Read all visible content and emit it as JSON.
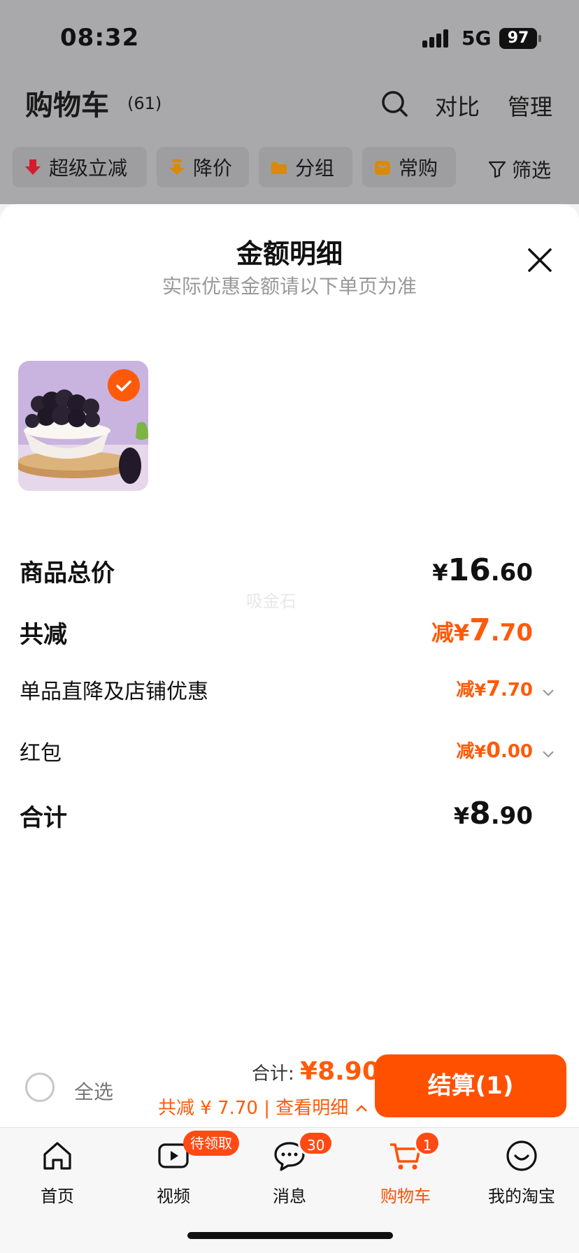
{
  "status_bar": {
    "time": "08:32",
    "network": "5G",
    "battery": "97"
  },
  "cart_header": {
    "title": "购物车",
    "count": "(61)",
    "compare": "对比",
    "manage": "管理"
  },
  "chips": [
    {
      "label": "超级立减",
      "icon": "red-down-arrow-icon"
    },
    {
      "label": "降价",
      "icon": "price-drop-icon"
    },
    {
      "label": "分组",
      "icon": "folder-icon"
    },
    {
      "label": "常购",
      "icon": "bag-icon"
    }
  ],
  "filter_label": "筛选",
  "sheet": {
    "title": "金额明细",
    "subtitle": "实际优惠金额请以下单页为准",
    "rows": {
      "subtotal": {
        "label": "商品总价",
        "yen": "¥",
        "int": "16",
        "dec": ".60"
      },
      "discount": {
        "label": "共减",
        "prefix": "减",
        "yen": "¥",
        "int": "7",
        "dec": ".70"
      },
      "item_discount": {
        "label": "单品直降及店铺优惠",
        "prefix": "减",
        "yen": "¥",
        "int": "7",
        "dec": ".70"
      },
      "red_packet": {
        "label": "红包",
        "prefix": "减",
        "yen": "¥",
        "int": "0",
        "dec": ".00"
      },
      "total": {
        "label": "合计",
        "yen": "¥",
        "int": "8",
        "dec": ".90"
      }
    },
    "watermark": "吸金石"
  },
  "action_bar": {
    "select_all": "全选",
    "total_label": "合计:",
    "total_amount": "¥8.90",
    "saved_text": "共减 ¥ 7.70",
    "detail_link": "查看明细",
    "checkout": "结算(1)"
  },
  "tab_bar": [
    {
      "label": "首页",
      "icon": "home-icon"
    },
    {
      "label": "视频",
      "icon": "video-icon",
      "badge": "待领取"
    },
    {
      "label": "消息",
      "icon": "message-icon",
      "badge": "30"
    },
    {
      "label": "购物车",
      "icon": "cart-icon",
      "badge": "1",
      "active": true
    },
    {
      "label": "我的淘宝",
      "icon": "profile-icon"
    }
  ],
  "colors": {
    "accent": "#ff5000",
    "discount": "#ff5a0a"
  }
}
